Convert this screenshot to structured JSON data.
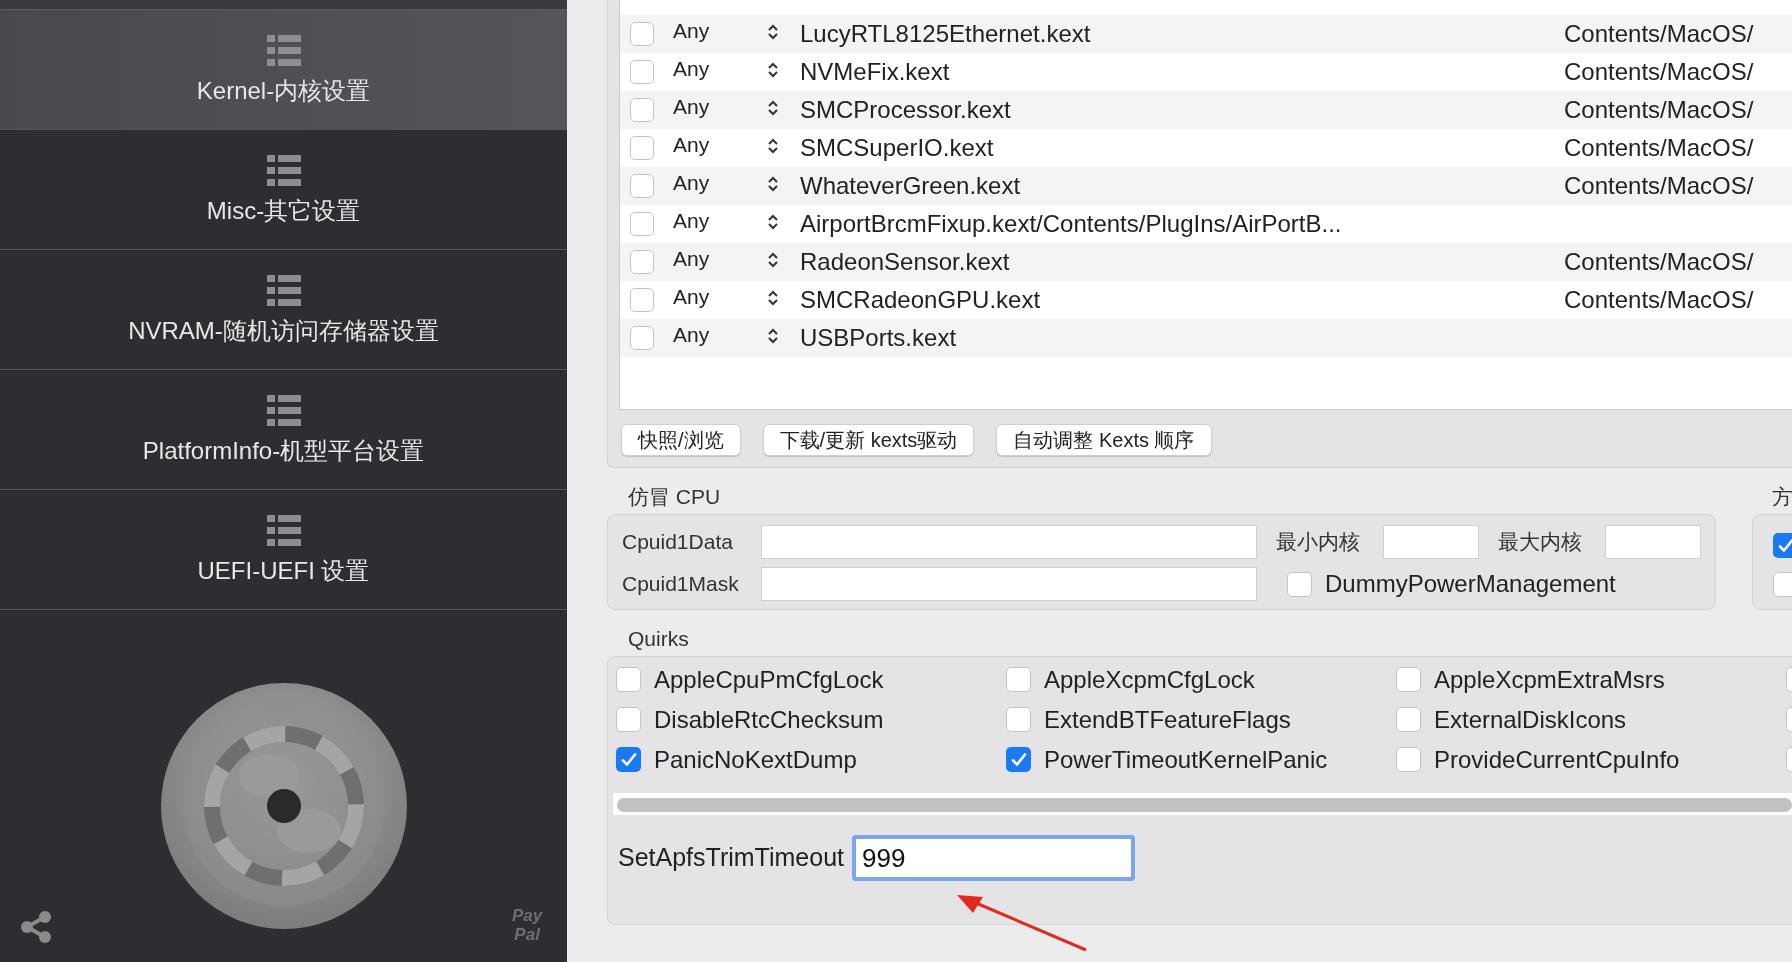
{
  "sidebar": {
    "items": [
      {
        "label": "Kernel-内核设置",
        "selected": true
      },
      {
        "label": "Misc-其它设置",
        "selected": false
      },
      {
        "label": "NVRAM-随机访问存储器设置",
        "selected": false
      },
      {
        "label": "PlatformInfo-机型平台设置",
        "selected": false
      },
      {
        "label": "UEFI-UEFI 设置",
        "selected": false
      }
    ],
    "paypal": [
      "Pay",
      "Pal"
    ]
  },
  "kext_table": {
    "rows": [
      {
        "enabled": false,
        "arch": "Any",
        "bundle": "LucyRTL8125Ethernet.kext",
        "executable": "Contents/MacOS/"
      },
      {
        "enabled": false,
        "arch": "Any",
        "bundle": "NVMeFix.kext",
        "executable": "Contents/MacOS/"
      },
      {
        "enabled": false,
        "arch": "Any",
        "bundle": "SMCProcessor.kext",
        "executable": "Contents/MacOS/"
      },
      {
        "enabled": false,
        "arch": "Any",
        "bundle": "SMCSuperIO.kext",
        "executable": "Contents/MacOS/"
      },
      {
        "enabled": false,
        "arch": "Any",
        "bundle": "WhateverGreen.kext",
        "executable": "Contents/MacOS/"
      },
      {
        "enabled": false,
        "arch": "Any",
        "bundle": "AirportBrcmFixup.kext/Contents/PlugIns/AirPortB..."
      },
      {
        "enabled": false,
        "arch": "Any",
        "bundle": "RadeonSensor.kext",
        "executable": "Contents/MacOS/"
      },
      {
        "enabled": false,
        "arch": "Any",
        "bundle": "SMCRadeonGPU.kext",
        "executable": "Contents/MacOS/"
      },
      {
        "enabled": false,
        "arch": "Any",
        "bundle": "USBPorts.kext"
      }
    ],
    "buttons": [
      "快照/浏览",
      "下载/更新 kexts驱动",
      "自动调整 Kexts 顺序"
    ]
  },
  "cpu": {
    "title": "仿冒 CPU",
    "cpuid1data_label": "Cpuid1Data",
    "min_cores_label": "最小内核",
    "max_cores_label": "最大内核",
    "cpuid1mask_label": "Cpuid1Mask",
    "dummy_power": {
      "label": "DummyPowerManagement",
      "checked": false
    }
  },
  "side_group": {
    "title": "方",
    "checks": [
      {
        "checked": true
      },
      {
        "checked": false
      }
    ]
  },
  "quirks": {
    "title": "Quirks",
    "columns": [
      [
        {
          "label": "AppleCpuPmCfgLock",
          "checked": false
        },
        {
          "label": "DisableRtcChecksum",
          "checked": false
        },
        {
          "label": "PanicNoKextDump",
          "checked": true
        }
      ],
      [
        {
          "label": "AppleXcpmCfgLock",
          "checked": false
        },
        {
          "label": "ExtendBTFeatureFlags",
          "checked": false
        },
        {
          "label": "PowerTimeoutKernelPanic",
          "checked": true
        }
      ],
      [
        {
          "label": "AppleXcpmExtraMsrs",
          "checked": false
        },
        {
          "label": "ExternalDiskIcons",
          "checked": false
        },
        {
          "label": "ProvideCurrentCpuInfo",
          "checked": false
        }
      ],
      [
        {
          "checked": false
        },
        {
          "checked": false
        },
        {
          "checked": false
        }
      ]
    ]
  },
  "apfs": {
    "label": "SetApfsTrimTimeout",
    "value": "999"
  }
}
